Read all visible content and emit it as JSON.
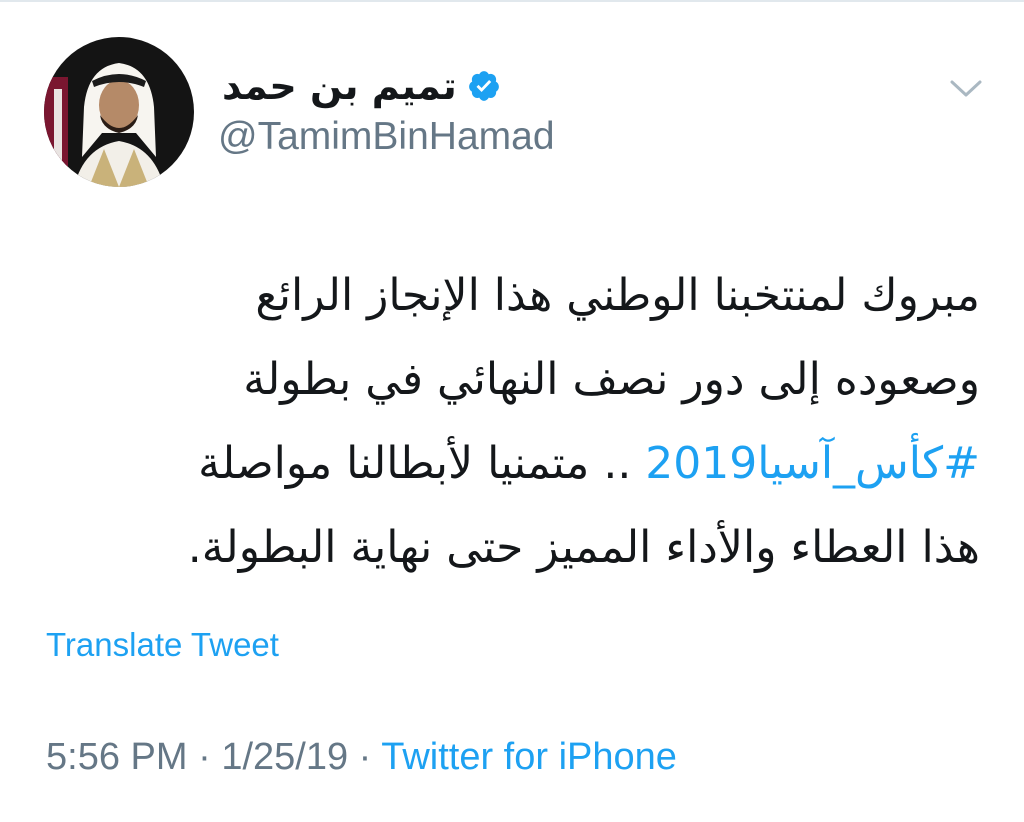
{
  "author": {
    "display_name": "تميم بن حمد",
    "handle": "@TamimBinHamad",
    "verified": true,
    "verified_icon": "verified-badge-icon",
    "avatar_icon": "profile-photo"
  },
  "menu_icon": "chevron-down-icon",
  "tweet": {
    "lines": [
      "مبروك لمنتخبنا الوطني هذا الإنجاز الرائع",
      "وصعوده إلى دور نصف النهائي في بطولة"
    ],
    "hashtag": "#كأس_آسيا2019",
    "line3_rest": " .. متمنيا لأبطالنا مواصلة",
    "line4": "هذا العطاء والأداء المميز حتى نهاية البطولة."
  },
  "translate_label": "Translate Tweet",
  "meta": {
    "time": "5:56 PM",
    "sep1": " · ",
    "date": "1/25/19",
    "sep2": " · ",
    "source": "Twitter for iPhone"
  },
  "colors": {
    "link_blue": "#1da1f2",
    "text": "#14171a",
    "muted": "#657786"
  }
}
